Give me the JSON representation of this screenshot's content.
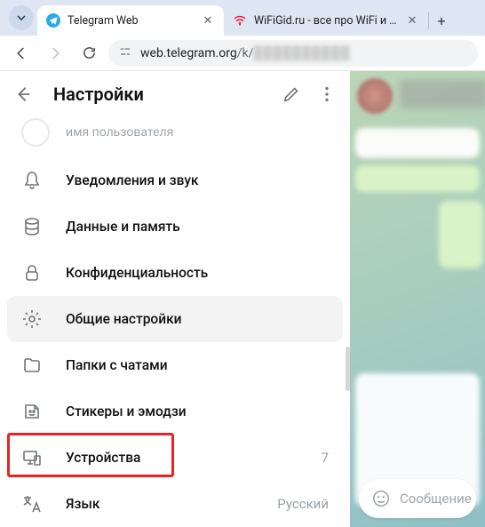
{
  "browser": {
    "tabs": [
      {
        "title": "Telegram Web",
        "favicon_color": "#2196f3"
      },
      {
        "title": "WiFiGid.ru - все про WiFi и бе",
        "favicon_color": "#ff0033"
      }
    ],
    "url_host": "web.telegram.org",
    "url_path": "/k/"
  },
  "panel": {
    "title": "Настройки",
    "profile_sub": "имя пользователя",
    "items": [
      {
        "icon": "bell",
        "label": "Уведомления и звук",
        "value": ""
      },
      {
        "icon": "data",
        "label": "Данные и память",
        "value": ""
      },
      {
        "icon": "lock",
        "label": "Конфиденциальность",
        "value": ""
      },
      {
        "icon": "gear",
        "label": "Общие настройки",
        "value": "",
        "selected": true
      },
      {
        "icon": "folder",
        "label": "Папки с чатами",
        "value": ""
      },
      {
        "icon": "sticker",
        "label": "Стикеры и эмодзи",
        "value": ""
      },
      {
        "icon": "devices",
        "label": "Устройства",
        "value": "7",
        "highlight": true
      },
      {
        "icon": "lang",
        "label": "Язык",
        "value": "Русский"
      }
    ]
  },
  "composer": {
    "placeholder": "Сообщение"
  }
}
